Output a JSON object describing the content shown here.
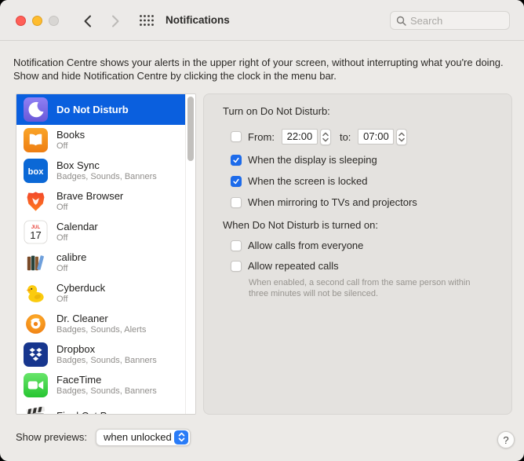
{
  "window": {
    "title": "Notifications",
    "search_placeholder": "Search",
    "description": "Notification Centre shows your alerts in the upper right of your screen, without interrupting what you're doing. Show and hide Notification Centre by clicking the clock in the menu bar."
  },
  "sidebar": {
    "items": [
      {
        "name": "Do Not Disturb",
        "subtitle": "",
        "icon": "do-not-disturb",
        "selected": true
      },
      {
        "name": "Books",
        "subtitle": "Off",
        "icon": "books",
        "selected": false
      },
      {
        "name": "Box Sync",
        "subtitle": "Badges, Sounds, Banners",
        "icon": "box-sync",
        "selected": false
      },
      {
        "name": "Brave Browser",
        "subtitle": "Off",
        "icon": "brave-browser",
        "selected": false
      },
      {
        "name": "Calendar",
        "subtitle": "Off",
        "icon": "calendar",
        "selected": false
      },
      {
        "name": "calibre",
        "subtitle": "Off",
        "icon": "calibre",
        "selected": false
      },
      {
        "name": "Cyberduck",
        "subtitle": "Off",
        "icon": "cyberduck",
        "selected": false
      },
      {
        "name": "Dr. Cleaner",
        "subtitle": "Badges, Sounds, Alerts",
        "icon": "dr-cleaner",
        "selected": false
      },
      {
        "name": "Dropbox",
        "subtitle": "Badges, Sounds, Banners",
        "icon": "dropbox",
        "selected": false
      },
      {
        "name": "FaceTime",
        "subtitle": "Badges, Sounds, Banners",
        "icon": "facetime",
        "selected": false
      },
      {
        "name": "Final Cut Pro",
        "subtitle": "",
        "icon": "final-cut-pro",
        "selected": false
      }
    ],
    "calendar_icon_month": "JUL",
    "calendar_icon_day": "17"
  },
  "panel": {
    "section1_label": "Turn on Do Not Disturb:",
    "from_label": "From:",
    "from_time": "22:00",
    "to_label": "to:",
    "to_time": "07:00",
    "schedule_checked": false,
    "checkboxes1": [
      {
        "label": "When the display is sleeping",
        "checked": true
      },
      {
        "label": "When the screen is locked",
        "checked": true
      },
      {
        "label": "When mirroring to TVs and projectors",
        "checked": false
      }
    ],
    "section2_label": "When Do Not Disturb is turned on:",
    "checkboxes2": [
      {
        "label": "Allow calls from everyone",
        "checked": false
      },
      {
        "label": "Allow repeated calls",
        "checked": false
      }
    ],
    "hint": "When enabled, a second call from the same person within three minutes will not be silenced."
  },
  "footer": {
    "show_previews_label": "Show previews:",
    "show_previews_value": "when unlocked",
    "help_label": "?"
  },
  "colors": {
    "selection_blue": "#0A5FDE",
    "checkbox_blue": "#1D6BEA",
    "popup_accent_blue": "#2A7CF7",
    "traffic_red": "#FF5F57",
    "traffic_yellow": "#FEBC2E",
    "traffic_disabled": "#D8D6D3"
  }
}
